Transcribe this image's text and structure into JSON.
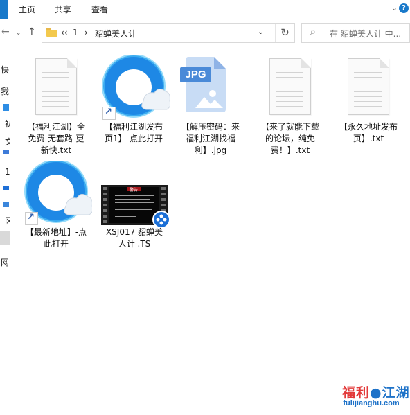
{
  "ribbon": {
    "tabs": [
      "主页",
      "共享",
      "查看"
    ],
    "help": "?"
  },
  "navigation": {
    "back_icon": "←",
    "forward_icon": "→",
    "recent_icon": "⌄",
    "up_icon": "↑",
    "breadcrumb": [
      "‹‹",
      "1",
      "›",
      "貂蝉美人计"
    ],
    "dropdown_icon": "⌄",
    "refresh_icon": "↻",
    "search_placeholder": "在 貂蝉美人计 中..."
  },
  "nav_pane": {
    "labels": [
      "快",
      "我",
      "初",
      "文",
      "1",
      "冈",
      "网"
    ]
  },
  "files": [
    {
      "name": "【福利江湖】全免费-无套路-更新快.txt",
      "label_lines": [
        "【福利江湖】全",
        "免费-无套路-更",
        "新快.txt"
      ],
      "type": "txt"
    },
    {
      "name": "【福利江湖发布页1】-点此打开",
      "label_lines": [
        "【福利江湖发布",
        "页1】-点此打开"
      ],
      "type": "shortcut"
    },
    {
      "name": "【解压密码：来福利江湖找福利】.jpg",
      "label_lines": [
        "【解压密码：来",
        "福利江湖找福",
        "利】.jpg"
      ],
      "type": "jpg",
      "badge": "JPG"
    },
    {
      "name": "【来了就能下载的论坛，纯免费！】.txt",
      "label_lines": [
        "【来了就能下载",
        "的论坛，纯免",
        "费！】.txt"
      ],
      "type": "txt"
    },
    {
      "name": "【永久地址发布页】.txt",
      "label_lines": [
        "【永久地址发布",
        "页】.txt"
      ],
      "type": "txt"
    },
    {
      "name": "【最新地址】-点此打开",
      "label_lines": [
        "【最新地址】-点",
        "此打开"
      ],
      "type": "shortcut"
    },
    {
      "name": "XSJ017 貂蝉美人计 .TS",
      "label_lines": [
        "XSJ017 貂蝉美",
        "人计 .TS"
      ],
      "type": "video",
      "thumb_title": "警告"
    }
  ],
  "watermark": {
    "text_red_1": "福利",
    "text_blue": "江湖",
    "domain": "fulijianghu.com"
  },
  "colors": {
    "accent": "#1979ca",
    "browser_icon_blue": "#1e88e5",
    "watermark_red": "#e23a3a"
  }
}
